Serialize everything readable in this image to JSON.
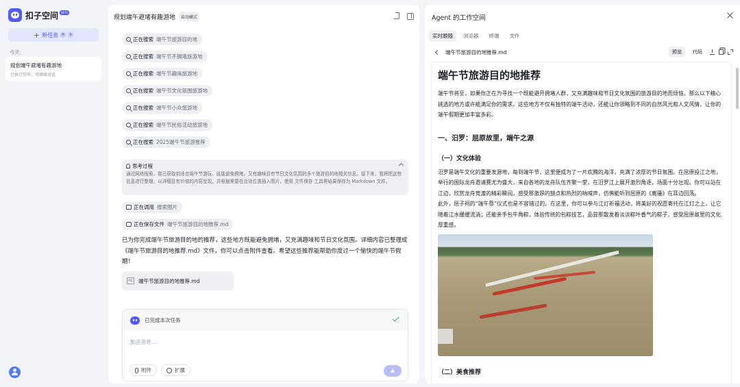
{
  "brand": {
    "name": "扣子空间",
    "badge": "BETA"
  },
  "sidebar": {
    "new_task_label": "新任务",
    "new_task_shortcut": [
      "⌘",
      "K"
    ],
    "section_today": "今天",
    "history": [
      {
        "title": "规划端午避堵有趣游地",
        "subtitle": "已执行完毕，可继续对话"
      }
    ]
  },
  "chat": {
    "title": "规划端午避堵有趣游地",
    "mode_badge": "自动模式",
    "steps": [
      {
        "action": "正在搜索",
        "detail": "端午节旅游目的地"
      },
      {
        "action": "正在搜索",
        "detail": "端午节不拥堵旅游地"
      },
      {
        "action": "正在搜索",
        "detail": "端午节趣味旅游地"
      },
      {
        "action": "正在搜索",
        "detail": "端午节文化氛围旅游地"
      },
      {
        "action": "正在搜索",
        "detail": "端午节小众旅游地"
      },
      {
        "action": "正在搜索",
        "detail": "端午节民俗活动旅游地"
      },
      {
        "action": "正在搜索",
        "detail": "2025端午节旅游推荐"
      }
    ],
    "thinking": {
      "title": "思考过程",
      "body": "通过网络搜索，我已获取到适合端午节游玩、既能避免拥堵，又有趣味且有节日文化氛围的多个旅游目的地相关信息。接下来，我将把这些信息进行整理，以详细且有价值的内容呈现，并根据需要在合适位置插入图片，使用 文件保存 工具将结果保存为 Markdown 文件。"
    },
    "step_image": {
      "action": "正在调用",
      "detail": "搜索图片"
    },
    "step_save": {
      "action": "正在保存文件",
      "detail": "端午节旅游目的地推荐.md"
    },
    "answer": "已为你完成端午节旅游目的地的推荐，这些地方既能避免拥堵，又充满趣味和节日文化氛围。详细内容已整理成《端午节旅游目的地推荐.md》文件，你可以点击附件查看。希望这些推荐能帮助你度过一个愉快的端午节假期！",
    "attachment": {
      "type_label": "MD",
      "name": "端午节旅游目的地推荐.md"
    },
    "composer": {
      "status": "已完成本次任务",
      "placeholder": "发送消息...",
      "attach_label": "附件",
      "expand_label": "扩展"
    }
  },
  "workspace": {
    "title": "Agent 的工作空间",
    "tabs": [
      "实时跟随",
      "浏览器",
      "终端",
      "文件"
    ],
    "active_tab": 0,
    "file_path": "端午节旅游目的地推荐.md",
    "preview_label": "预览",
    "code_label": "代码",
    "doc": {
      "h1": "端午节旅游目的地推荐",
      "intro": "端午节将至，如果你正在为寻找一个既能避开拥堵人群，又充满趣味和节日文化氛围的旅游目的地而烦恼，那么以下精心挑选的地方或许能满足你的需求。这些地方不仅有独特的端午活动，还能让你领略到不同的自然风光和人文风情，让你的端午假期更加丰富多彩。",
      "h2": "一、汨罗：屈原故里，端午之源",
      "h3": "（一）文化体验",
      "para1": "汨罗是端午文化的重要发源地，每到端午节，这里便成为了一片欢腾的海洋，充满了浓厚的节日氛围。在屈原投江之地，举行的国际龙舟邀请赛尤为盛大，来自各地的龙舟队伍齐聚一堂，在汨罗江上展开激烈角逐，场面十分壮观。你可以站在江边，欣赏龙舟竞渡的精彩瞬间，感受那激昂的鼓点和热烈的呐喊声，仿佛能听到屈原的《离骚》在耳边回荡。",
      "para2": "此外，屈子祠的“端午祭”仪式也是不容错过的。在这里，你可以参与江灯祈福活动，将美好的祝愿寄托在江灯之上，让它随着江水缓缓流淌；还能亲手包牛角粽，体验传统的包粽技艺，品尝那散发着淡淡粽叶香气的粽子，感受屈原故里的文化厚重感。",
      "h3b": "（二）美食推荐"
    }
  },
  "colors": {
    "accent": "#4f5bff",
    "success": "#3bb35b"
  }
}
